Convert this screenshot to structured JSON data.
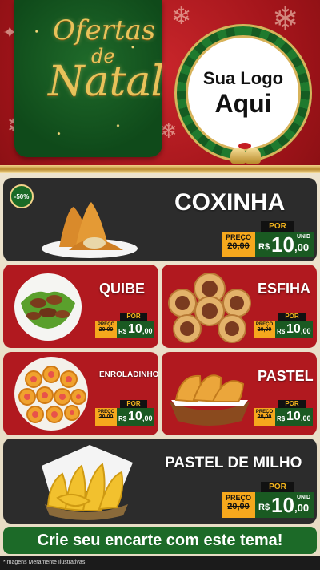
{
  "header": {
    "title_line1": "Ofertas",
    "title_line2": "de",
    "title_line3": "Natal",
    "logo_line1": "Sua Logo",
    "logo_line2": "Aqui"
  },
  "products": [
    {
      "name": "COXINHA",
      "badge": "-50%",
      "por": "POR",
      "preco": "PREÇO",
      "old": "20,00",
      "rs": "R$",
      "value": "10",
      "cents": ",00",
      "unid": "UNID"
    },
    {
      "name": "QUIBE",
      "por": "POR",
      "preco": "PREÇO",
      "old": "20,00",
      "rs": "R$",
      "value": "10",
      "cents": ",00"
    },
    {
      "name": "ESFIHA",
      "por": "POR",
      "preco": "PREÇO",
      "old": "20,00",
      "rs": "R$",
      "value": "10",
      "cents": ",00"
    },
    {
      "name": "ENROLADINHO",
      "por": "POR",
      "preco": "PREÇO",
      "old": "20,00",
      "rs": "R$",
      "value": "10",
      "cents": ",00"
    },
    {
      "name": "PASTEL",
      "por": "POR",
      "preco": "PREÇO",
      "old": "20,00",
      "rs": "R$",
      "value": "10",
      "cents": ",00"
    },
    {
      "name": "PASTEL DE MILHO",
      "por": "POR",
      "preco": "PREÇO",
      "old": "20,00",
      "rs": "R$",
      "value": "10",
      "cents": ",00",
      "unid": "UNID"
    }
  ],
  "cta": "Crie seu encarte com este tema!",
  "footer_note": "*Imagens Meramente Ilustrativas",
  "colors": {
    "red": "#b1191f",
    "green": "#1a5a22",
    "gold": "#f6a81d",
    "dark": "#2c2c2c"
  }
}
